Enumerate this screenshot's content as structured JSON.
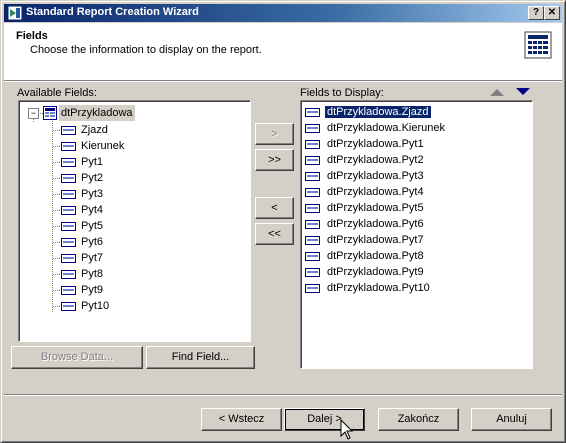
{
  "window": {
    "title": "Standard Report Creation Wizard",
    "help_btn": "?",
    "close_btn": "✕"
  },
  "header": {
    "title": "Fields",
    "subtitle": "Choose the information to display on the report."
  },
  "available": {
    "label": "Available Fields:",
    "root": "dtPrzykladowa",
    "root_toggle": "−",
    "fields": [
      "Zjazd",
      "Kierunek",
      "Pyt1",
      "Pyt2",
      "Pyt3",
      "Pyt4",
      "Pyt5",
      "Pyt6",
      "Pyt7",
      "Pyt8",
      "Pyt9",
      "Pyt10"
    ]
  },
  "display": {
    "label": "Fields to Display:",
    "fields": [
      "dtPrzykladowa.Zjazd",
      "dtPrzykladowa.Kierunek",
      "dtPrzykladowa.Pyt1",
      "dtPrzykladowa.Pyt2",
      "dtPrzykladowa.Pyt3",
      "dtPrzykladowa.Pyt4",
      "dtPrzykladowa.Pyt5",
      "dtPrzykladowa.Pyt6",
      "dtPrzykladowa.Pyt7",
      "dtPrzykladowa.Pyt8",
      "dtPrzykladowa.Pyt9",
      "dtPrzykladowa.Pyt10"
    ],
    "selected_index": 0
  },
  "transfer": {
    "add": ">",
    "add_all": ">>",
    "remove": "<",
    "remove_all": "<<"
  },
  "actions": {
    "browse": "Browse Data...",
    "find": "Find Field..."
  },
  "nav": {
    "back": "< Wstecz",
    "next": "Dalej >",
    "finish": "Zakończ",
    "cancel": "Anuluj"
  },
  "colors": {
    "title_start": "#0a246a",
    "title_end": "#a6caf0",
    "selection": "#0a246a",
    "arrow_up": "#808080",
    "arrow_down": "#000080"
  }
}
